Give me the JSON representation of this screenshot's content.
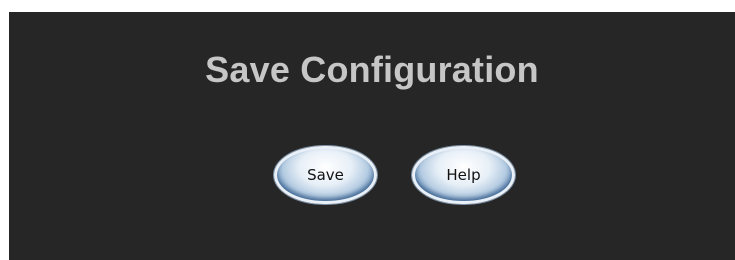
{
  "page": {
    "title": "Save Configuration"
  },
  "actions": {
    "save_label": "Save",
    "help_label": "Help"
  },
  "colors": {
    "panel_background": "#262626",
    "title_text": "#c6c6c6",
    "button_face": "#e7eff7",
    "button_edge": "#1f4e86"
  }
}
